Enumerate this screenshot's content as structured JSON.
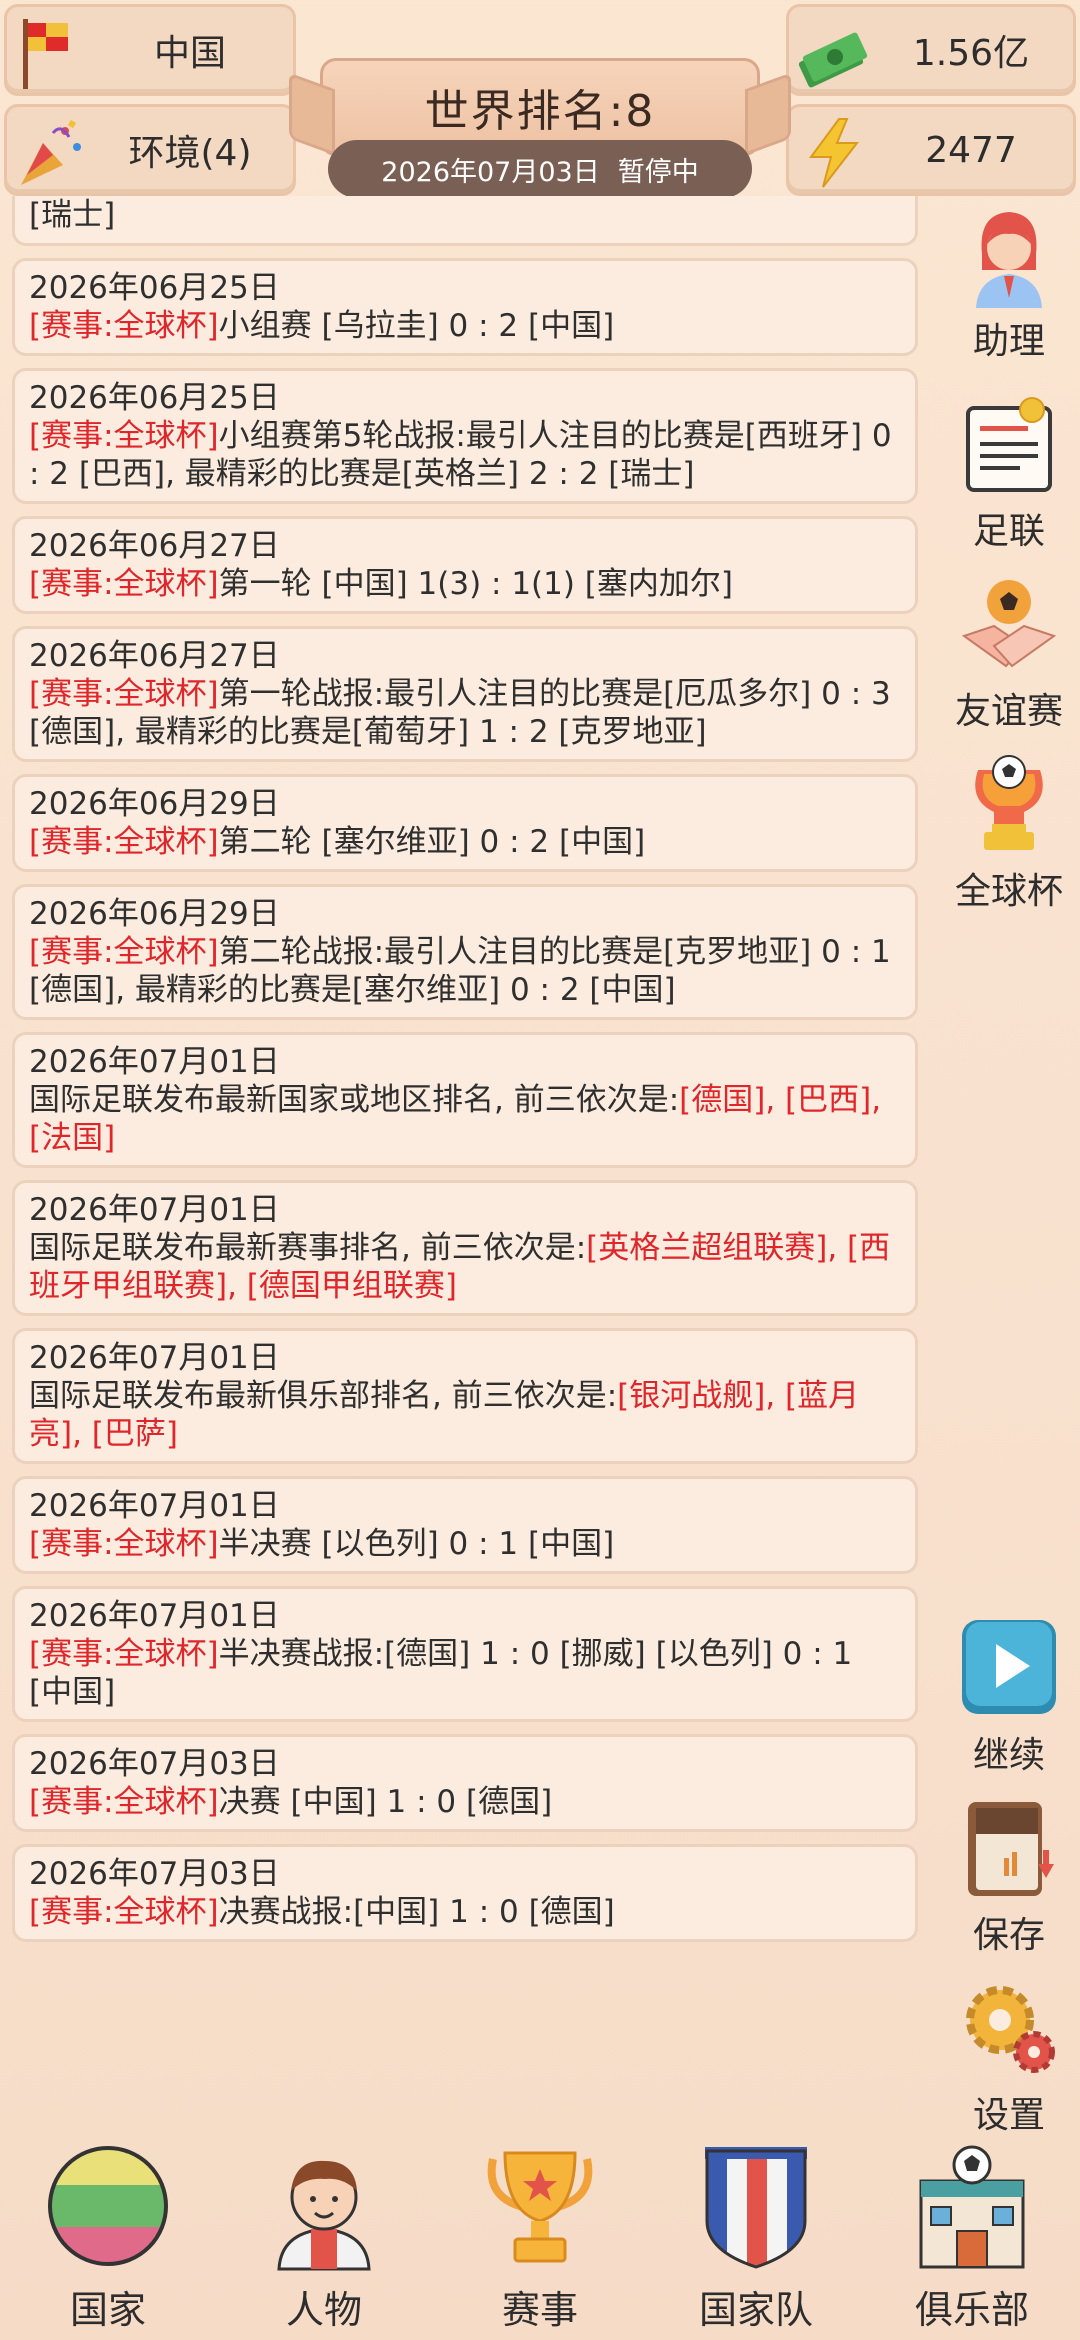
{
  "top_bar": {
    "country": "中国",
    "environment": "环境(4)",
    "money": "1.56亿",
    "energy": "2477",
    "world_rank": "世界排名:8",
    "current_date": "2026年07月03日",
    "status": "暂停中"
  },
  "feed": {
    "partial_text": "[瑞士]",
    "items": [
      {
        "date": "2026年06月25日",
        "tag": "[赛事:全球杯]",
        "text": "小组赛 [乌拉圭] 0 : 2 [中国]"
      },
      {
        "date": "2026年06月25日",
        "tag": "[赛事:全球杯]",
        "text": "小组赛第5轮战报:最引人注目的比赛是[西班牙] 0 : 2 [巴西], 最精彩的比赛是[英格兰] 2 : 2 [瑞士]"
      },
      {
        "date": "2026年06月27日",
        "tag": "[赛事:全球杯]",
        "text": "第一轮 [中国] 1(3) : 1(1) [塞内加尔]"
      },
      {
        "date": "2026年06月27日",
        "tag": "[赛事:全球杯]",
        "text": "第一轮战报:最引人注目的比赛是[厄瓜多尔] 0 : 3 [德国], 最精彩的比赛是[葡萄牙] 1 : 2 [克罗地亚]"
      },
      {
        "date": "2026年06月29日",
        "tag": "[赛事:全球杯]",
        "text": "第二轮 [塞尔维亚] 0 : 2 [中国]"
      },
      {
        "date": "2026年06月29日",
        "tag": "[赛事:全球杯]",
        "text": "第二轮战报:最引人注目的比赛是[克罗地亚] 0 : 1 [德国], 最精彩的比赛是[塞尔维亚] 0 : 2 [中国]"
      },
      {
        "date": "2026年07月01日",
        "prefix": "国际足联发布最新国家或地区排名, 前三依次是:",
        "highlights": "[德国], [巴西], [法国]"
      },
      {
        "date": "2026年07月01日",
        "prefix": "国际足联发布最新赛事排名, 前三依次是:",
        "highlights": "[英格兰超组联赛], [西班牙甲组联赛], [德国甲组联赛]"
      },
      {
        "date": "2026年07月01日",
        "prefix": "国际足联发布最新俱乐部排名, 前三依次是:",
        "highlights": "[银河战舰], [蓝月亮], [巴萨]"
      },
      {
        "date": "2026年07月01日",
        "tag": "[赛事:全球杯]",
        "text": "半决赛 [以色列] 0 : 1 [中国]"
      },
      {
        "date": "2026年07月01日",
        "tag": "[赛事:全球杯]",
        "text": "半决赛战报:[德国] 1 : 0 [挪威] [以色列] 0 : 1 [中国]"
      },
      {
        "date": "2026年07月03日",
        "tag": "[赛事:全球杯]",
        "text": "决赛 [中国] 1 : 0 [德国]"
      },
      {
        "date": "2026年07月03日",
        "tag": "[赛事:全球杯]",
        "text": "决赛战报:[中国] 1 : 0 [德国]"
      }
    ]
  },
  "side_menu": {
    "assistant": "助理",
    "federation": "足联",
    "friendly": "友谊赛",
    "worldcup": "全球杯",
    "continue": "继续",
    "save": "保存",
    "settings": "设置"
  },
  "bottom_nav": {
    "country": "国家",
    "people": "人物",
    "events": "赛事",
    "national_team": "国家队",
    "club": "俱乐部"
  },
  "colors": {
    "highlight_red": "#e0262a",
    "card_bg": "#fbecdf",
    "page_bg": "#f8e2cf"
  },
  "icons": {
    "country": "flag-icon",
    "environment": "party-popper-icon",
    "money": "money-stack-icon",
    "energy": "lightning-icon"
  }
}
